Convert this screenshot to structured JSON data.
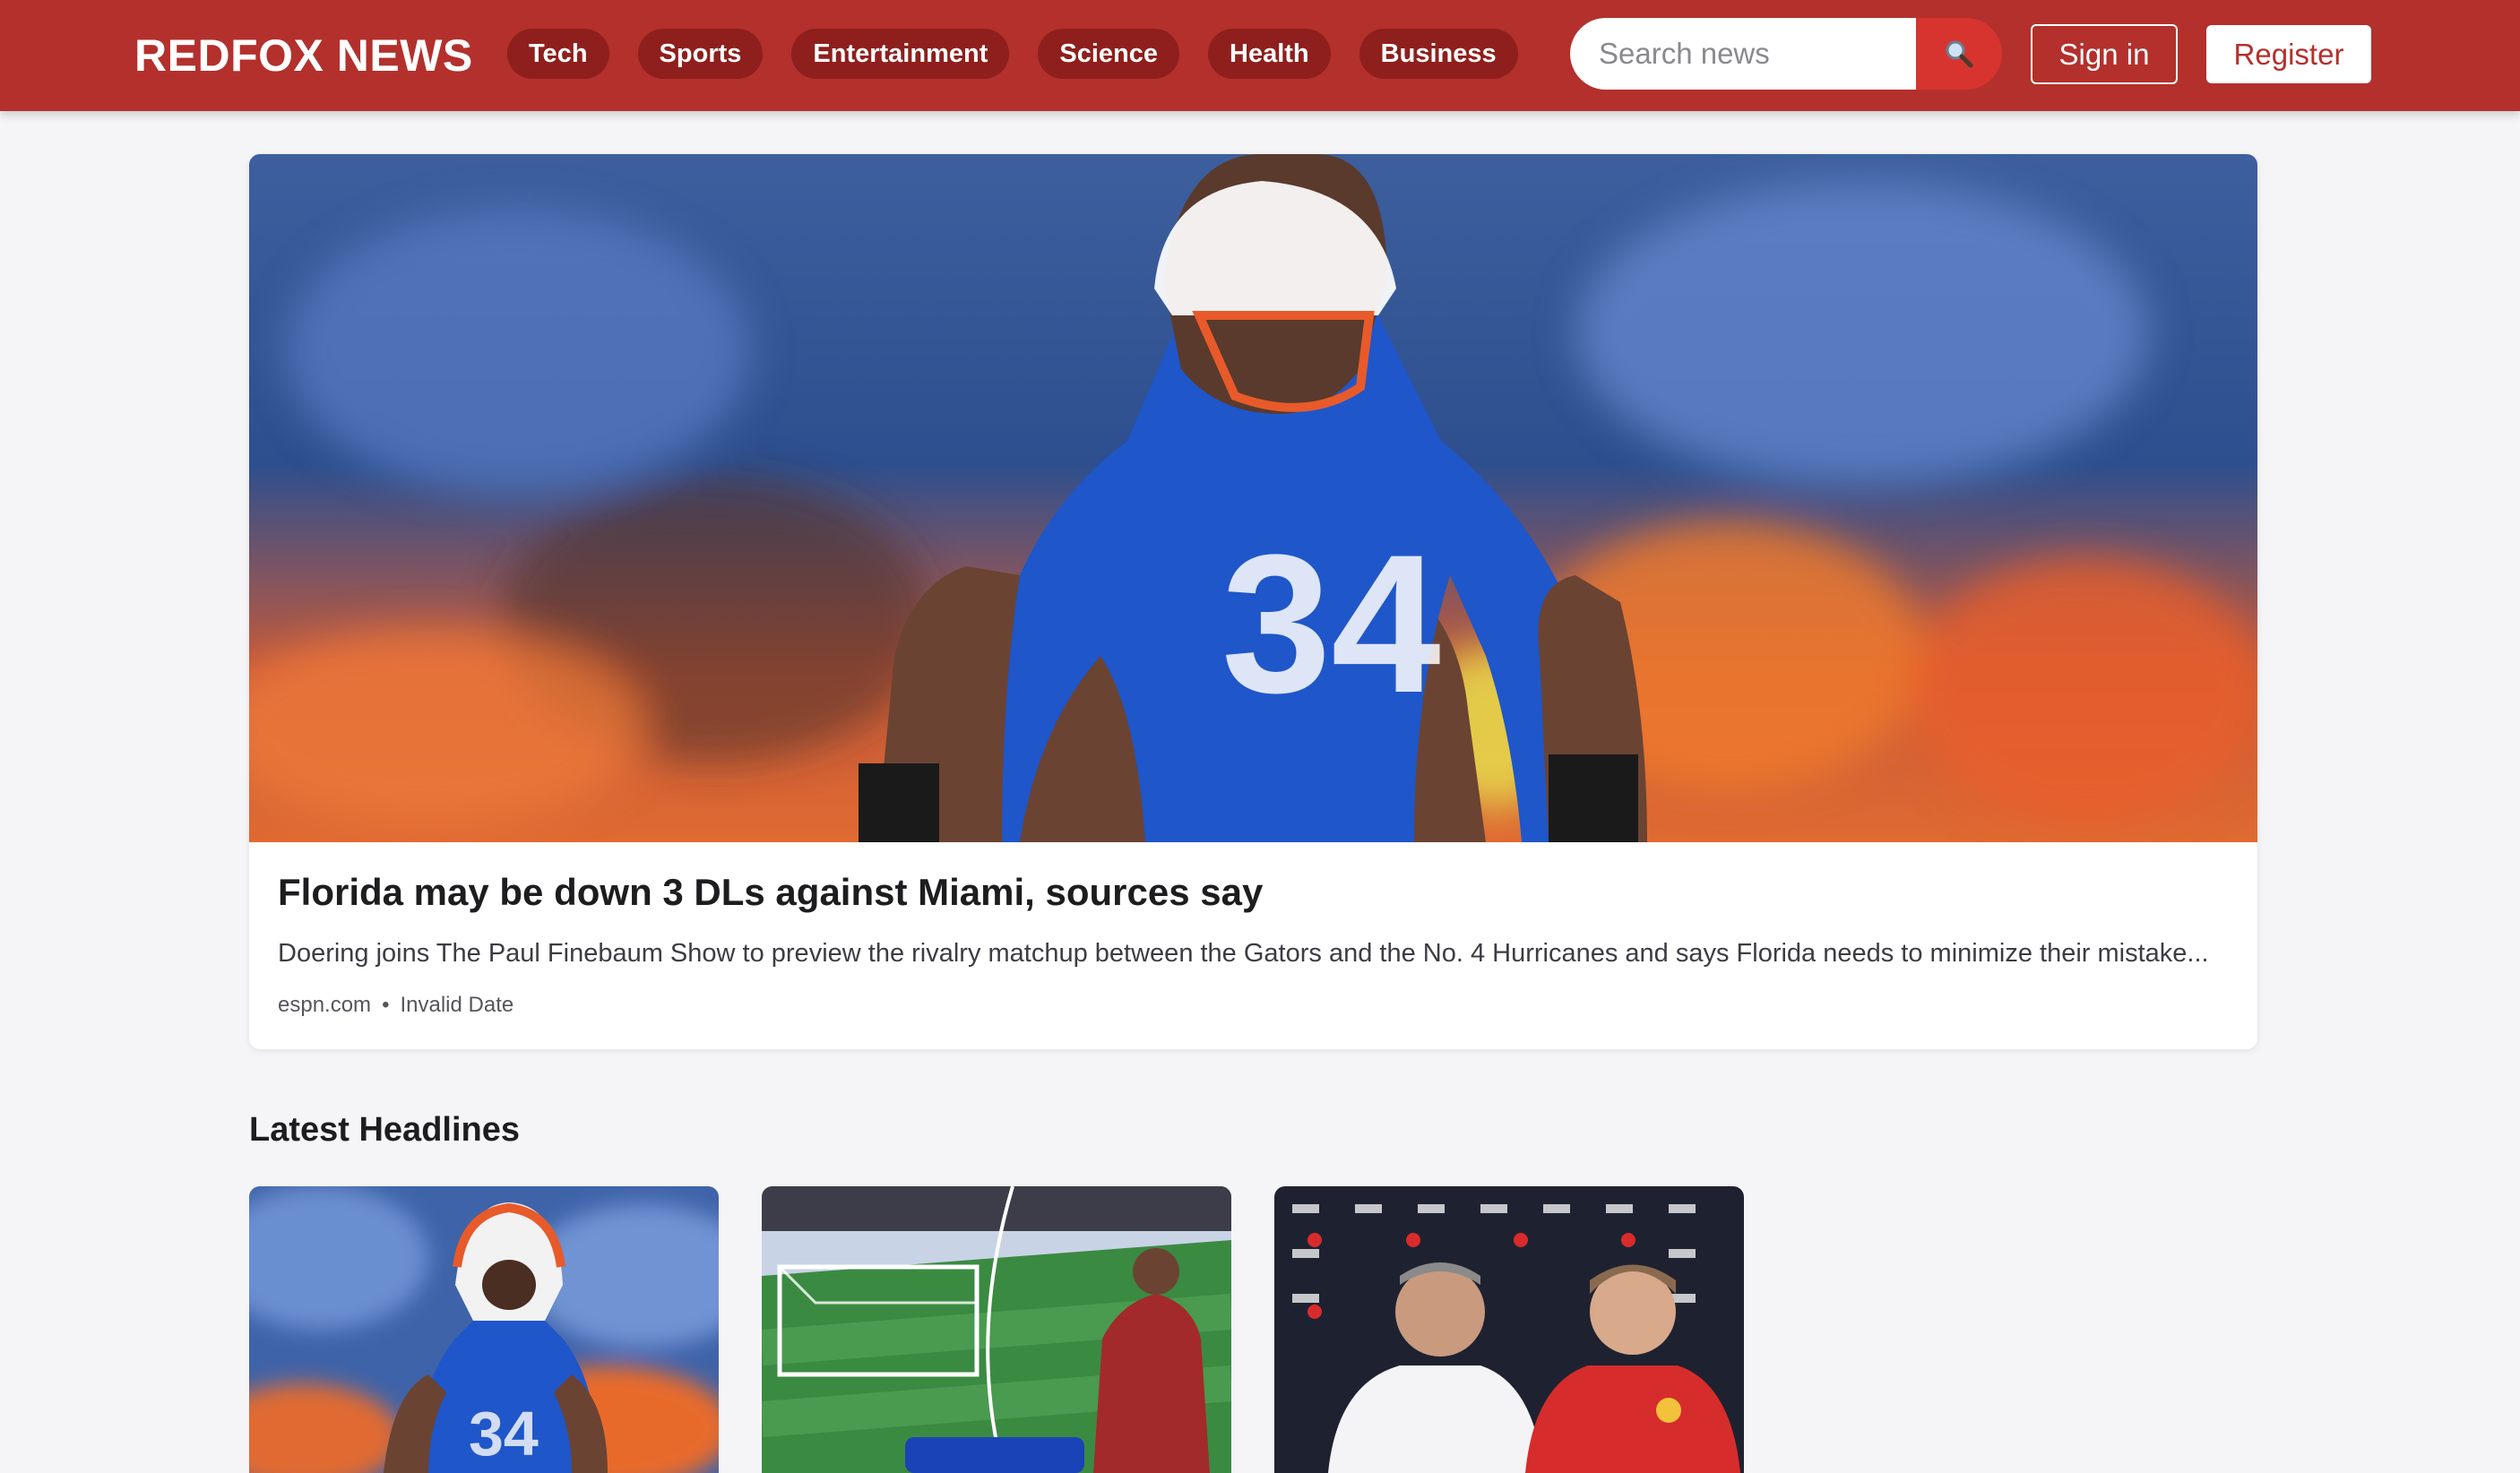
{
  "header": {
    "brand": "REDFOX NEWS",
    "categories": [
      "Tech",
      "Sports",
      "Entertainment",
      "Science",
      "Health",
      "Business"
    ],
    "search": {
      "placeholder": "Search news",
      "value": ""
    },
    "search_icon": "magnifier-icon",
    "signin_label": "Sign in",
    "register_label": "Register"
  },
  "hero": {
    "title": "Florida may be down 3 DLs against Miami, sources say",
    "description": "Doering joins The Paul Finebaum Show to preview the rivalry matchup between the Gators and the No. 4 Hurricanes and says Florida needs to minimize their mistake...",
    "source": "espn.com",
    "separator": "•",
    "date": "Invalid Date",
    "image_jersey_number": "34"
  },
  "latest": {
    "heading": "Latest Headlines"
  },
  "colors": {
    "brand_red": "#b3302c",
    "pill_red": "#8e1f1c",
    "search_button": "#d7342f",
    "page_background": "#f5f5f7"
  }
}
